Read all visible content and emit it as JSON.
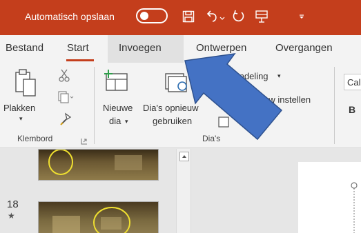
{
  "titlebar": {
    "autosave_label": "Automatisch opslaan",
    "save_icon": "save-icon",
    "undo_icon": "undo-icon",
    "redo_icon": "redo-icon",
    "present_icon": "present-icon",
    "customize_icon": "customize-icon"
  },
  "tabs": {
    "bestand": "Bestand",
    "start": "Start",
    "invoegen": "Invoegen",
    "ontwerpen": "Ontwerpen",
    "overgangen": "Overgangen"
  },
  "ribbon": {
    "plakken": "Plakken",
    "nieuwe_line1": "Nieuwe",
    "nieuwe_line2": "dia",
    "hergebruiken_line1": "Dia's opnieuw",
    "hergebruiken_line2": "gebruiken",
    "indeling": "Indeling",
    "opnieuw_instellen": "ieuw instellen",
    "font_name": "Cal",
    "bold": "B",
    "group_klembord": "Klembord",
    "group_dias": "Dia's"
  },
  "slides": {
    "number": "18",
    "star": "★"
  },
  "colors": {
    "accent": "#c43e1c",
    "arrow": "#4472c4"
  }
}
